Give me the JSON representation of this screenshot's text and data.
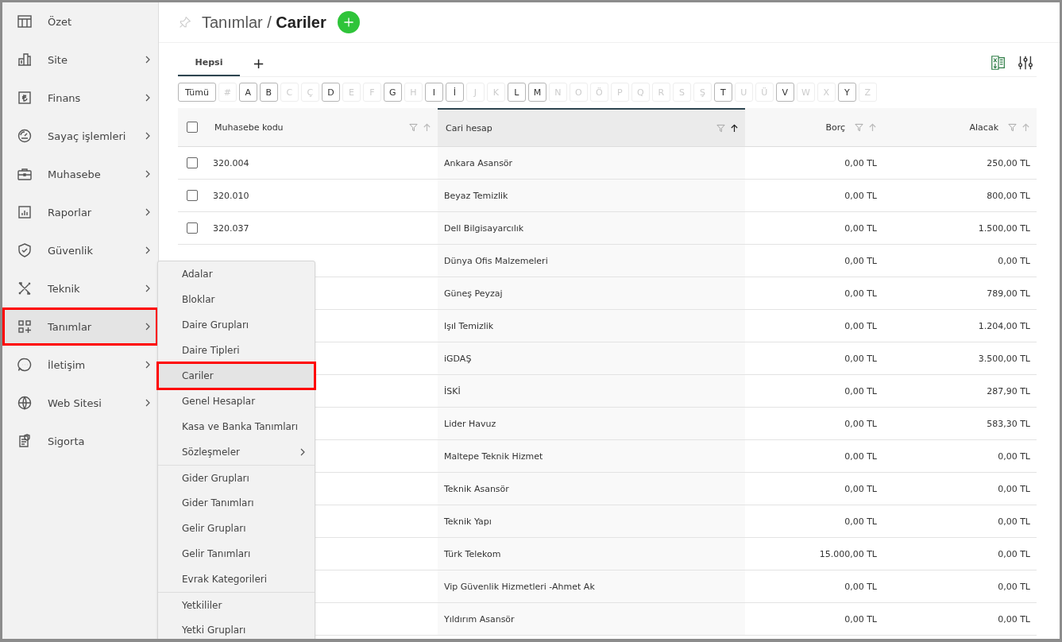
{
  "sidebar": {
    "items": [
      {
        "label": "Özet",
        "submenu": false,
        "selected": false
      },
      {
        "label": "Site",
        "submenu": true,
        "selected": false
      },
      {
        "label": "Finans",
        "submenu": true,
        "selected": false
      },
      {
        "label": "Sayaç işlemleri",
        "submenu": true,
        "selected": false
      },
      {
        "label": "Muhasebe",
        "submenu": true,
        "selected": false
      },
      {
        "label": "Raporlar",
        "submenu": true,
        "selected": false
      },
      {
        "label": "Güvenlik",
        "submenu": true,
        "selected": false
      },
      {
        "label": "Teknik",
        "submenu": true,
        "selected": false
      },
      {
        "label": "Tanımlar",
        "submenu": true,
        "selected": true
      },
      {
        "label": "İletişim",
        "submenu": true,
        "selected": false
      },
      {
        "label": "Web Sitesi",
        "submenu": true,
        "selected": false
      },
      {
        "label": "Sigorta",
        "submenu": false,
        "selected": false
      }
    ]
  },
  "header": {
    "section": "Tanımlar",
    "separator": "/",
    "title": "Cariler"
  },
  "tabs": [
    {
      "label": "Hepsi",
      "selected": true
    }
  ],
  "add_tab": "+",
  "letters": [
    {
      "label": "Tümü",
      "enabled": true
    },
    {
      "label": "#",
      "enabled": false
    },
    {
      "label": "A",
      "enabled": true
    },
    {
      "label": "B",
      "enabled": true
    },
    {
      "label": "C",
      "enabled": false
    },
    {
      "label": "Ç",
      "enabled": false
    },
    {
      "label": "D",
      "enabled": true
    },
    {
      "label": "E",
      "enabled": false
    },
    {
      "label": "F",
      "enabled": false
    },
    {
      "label": "G",
      "enabled": true
    },
    {
      "label": "H",
      "enabled": false
    },
    {
      "label": "I",
      "enabled": true
    },
    {
      "label": "İ",
      "enabled": true
    },
    {
      "label": "J",
      "enabled": false
    },
    {
      "label": "K",
      "enabled": false
    },
    {
      "label": "L",
      "enabled": true
    },
    {
      "label": "M",
      "enabled": true
    },
    {
      "label": "N",
      "enabled": false
    },
    {
      "label": "O",
      "enabled": false
    },
    {
      "label": "Ö",
      "enabled": false
    },
    {
      "label": "P",
      "enabled": false
    },
    {
      "label": "Q",
      "enabled": false
    },
    {
      "label": "R",
      "enabled": false
    },
    {
      "label": "S",
      "enabled": false
    },
    {
      "label": "Ş",
      "enabled": false
    },
    {
      "label": "T",
      "enabled": true
    },
    {
      "label": "U",
      "enabled": false
    },
    {
      "label": "Ü",
      "enabled": false
    },
    {
      "label": "V",
      "enabled": true
    },
    {
      "label": "W",
      "enabled": false
    },
    {
      "label": "X",
      "enabled": false
    },
    {
      "label": "Y",
      "enabled": true
    },
    {
      "label": "Z",
      "enabled": false
    }
  ],
  "table": {
    "columns": [
      {
        "label": "Muhasebe kodu",
        "sorted": false
      },
      {
        "label": "Cari hesap",
        "sorted": true
      },
      {
        "label": "Borç",
        "sorted": false
      },
      {
        "label": "Alacak",
        "sorted": false
      }
    ],
    "select_all_checked": false,
    "rows": [
      {
        "checked": false,
        "code": "320.004",
        "name": "Ankara Asansör",
        "debit": "0,00 TL",
        "credit": "250,00 TL"
      },
      {
        "checked": false,
        "code": "320.010",
        "name": "Beyaz Temizlik",
        "debit": "0,00 TL",
        "credit": "800,00 TL"
      },
      {
        "checked": false,
        "code": "320.037",
        "name": "Dell Bilgisayarcılık",
        "debit": "0,00 TL",
        "credit": "1.500,00 TL"
      },
      {
        "name": "Dünya Ofis Malzemeleri",
        "debit": "0,00 TL",
        "credit": "0,00 TL"
      },
      {
        "name": "Güneş Peyzaj",
        "debit": "0,00 TL",
        "credit": "789,00 TL"
      },
      {
        "name": "Işıl Temizlik",
        "debit": "0,00 TL",
        "credit": "1.204,00 TL"
      },
      {
        "name": "iGDAŞ",
        "debit": "0,00 TL",
        "credit": "3.500,00 TL"
      },
      {
        "name": "İSKİ",
        "debit": "0,00 TL",
        "credit": "287,90 TL"
      },
      {
        "name": "Lider Havuz",
        "debit": "0,00 TL",
        "credit": "583,30 TL"
      },
      {
        "name": "Maltepe Teknik Hizmet",
        "debit": "0,00 TL",
        "credit": "0,00 TL"
      },
      {
        "name": "Teknik Asansör",
        "debit": "0,00 TL",
        "credit": "0,00 TL"
      },
      {
        "name": "Teknik Yapı",
        "debit": "0,00 TL",
        "credit": "0,00 TL"
      },
      {
        "name": "Türk Telekom",
        "debit": "15.000,00 TL",
        "credit": "0,00 TL"
      },
      {
        "name": "Vip Güvenlik Hizmetleri -Ahmet Ak",
        "debit": "0,00 TL",
        "credit": "0,00 TL"
      },
      {
        "name": "Yıldırım Asansör",
        "debit": "0,00 TL",
        "credit": "0,00 TL"
      }
    ]
  },
  "submenu": {
    "items": [
      {
        "label": "Adalar",
        "selected": false,
        "submenu": false,
        "divider_before": false
      },
      {
        "label": "Bloklar",
        "selected": false,
        "submenu": false,
        "divider_before": false
      },
      {
        "label": "Daire Grupları",
        "selected": false,
        "submenu": false,
        "divider_before": false
      },
      {
        "label": "Daire Tipleri",
        "selected": false,
        "submenu": false,
        "divider_before": false
      },
      {
        "label": "Cariler",
        "selected": true,
        "submenu": false,
        "divider_before": false
      },
      {
        "label": "Genel Hesaplar",
        "selected": false,
        "submenu": false,
        "divider_before": false
      },
      {
        "label": "Kasa ve Banka Tanımları",
        "selected": false,
        "submenu": false,
        "divider_before": false
      },
      {
        "label": "Sözleşmeler",
        "selected": false,
        "submenu": true,
        "divider_before": false
      },
      {
        "label": "Gider Grupları",
        "selected": false,
        "submenu": false,
        "divider_before": true
      },
      {
        "label": "Gider Tanımları",
        "selected": false,
        "submenu": false,
        "divider_before": false
      },
      {
        "label": "Gelir Grupları",
        "selected": false,
        "submenu": false,
        "divider_before": false
      },
      {
        "label": "Gelir Tanımları",
        "selected": false,
        "submenu": false,
        "divider_before": false
      },
      {
        "label": "Evrak Kategorileri",
        "selected": false,
        "submenu": false,
        "divider_before": false
      },
      {
        "label": "Yetkililer",
        "selected": false,
        "submenu": false,
        "divider_before": true
      },
      {
        "label": "Yetki Grupları",
        "selected": false,
        "submenu": false,
        "divider_before": false
      }
    ]
  }
}
